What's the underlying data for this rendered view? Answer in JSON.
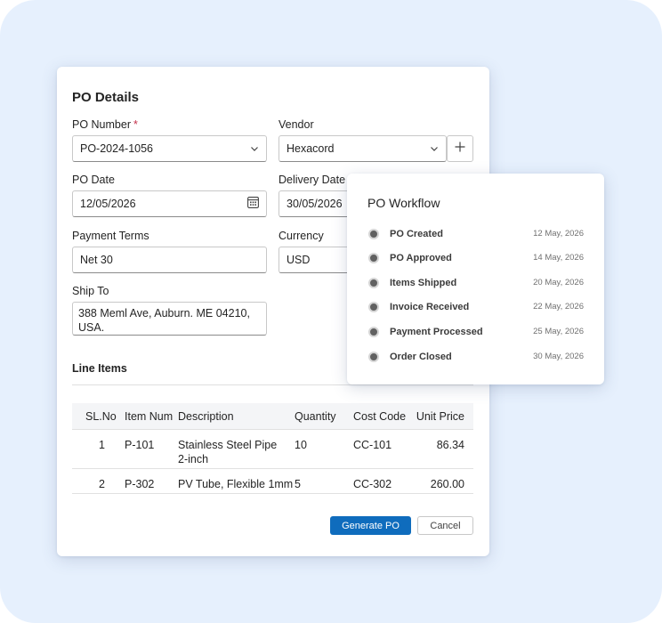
{
  "form": {
    "title": "PO Details",
    "po_number": {
      "label": "PO Number",
      "required_mark": "*",
      "value": "PO-2024-1056"
    },
    "vendor": {
      "label": "Vendor",
      "value": "Hexacord"
    },
    "po_date": {
      "label": "PO Date",
      "value": "12/05/2026"
    },
    "delivery_date": {
      "label": "Delivery Date",
      "value": "30/05/2026"
    },
    "payment_terms": {
      "label": "Payment Terms",
      "value": "Net 30"
    },
    "currency": {
      "label": "Currency",
      "value": "USD"
    },
    "ship_to": {
      "label": "Ship To",
      "line1": "388 Meml Ave, Auburn. ME 04210,",
      "line2": "USA."
    }
  },
  "line_items": {
    "title": "Line Items",
    "columns": [
      "SL.No",
      "Item Num",
      "Description",
      "Quantity",
      "Cost Code",
      "Unit Price"
    ],
    "rows": [
      {
        "sl": "1",
        "item": "P-101",
        "desc1": "Stainless Steel Pipe",
        "desc2": "2-inch",
        "qty": "10",
        "cost": "CC-101",
        "price": "86.34"
      },
      {
        "sl": "2",
        "item": "P-302",
        "desc1": "PV Tube, Flexible 1mm",
        "desc2": "",
        "qty": "5",
        "cost": "CC-302",
        "price": "260.00"
      }
    ]
  },
  "actions": {
    "primary": "Generate PO",
    "secondary": "Cancel"
  },
  "workflow": {
    "title": "PO Workflow",
    "steps": [
      {
        "name": "PO Created",
        "date": "12 May, 2026"
      },
      {
        "name": "PO Approved",
        "date": "14 May, 2026"
      },
      {
        "name": "Items Shipped",
        "date": "20 May, 2026"
      },
      {
        "name": "Invoice Received",
        "date": "22 May, 2026"
      },
      {
        "name": "Payment Processed",
        "date": "25 May, 2026"
      },
      {
        "name": "Order Closed",
        "date": "30 May, 2026"
      }
    ]
  },
  "colors": {
    "background": "#e6f0fd",
    "primary": "#0f6cbd",
    "required": "#c4314b",
    "step_dot": "#616161"
  },
  "icons": [
    "chevron-down-icon",
    "plus-icon",
    "calendar-icon"
  ]
}
